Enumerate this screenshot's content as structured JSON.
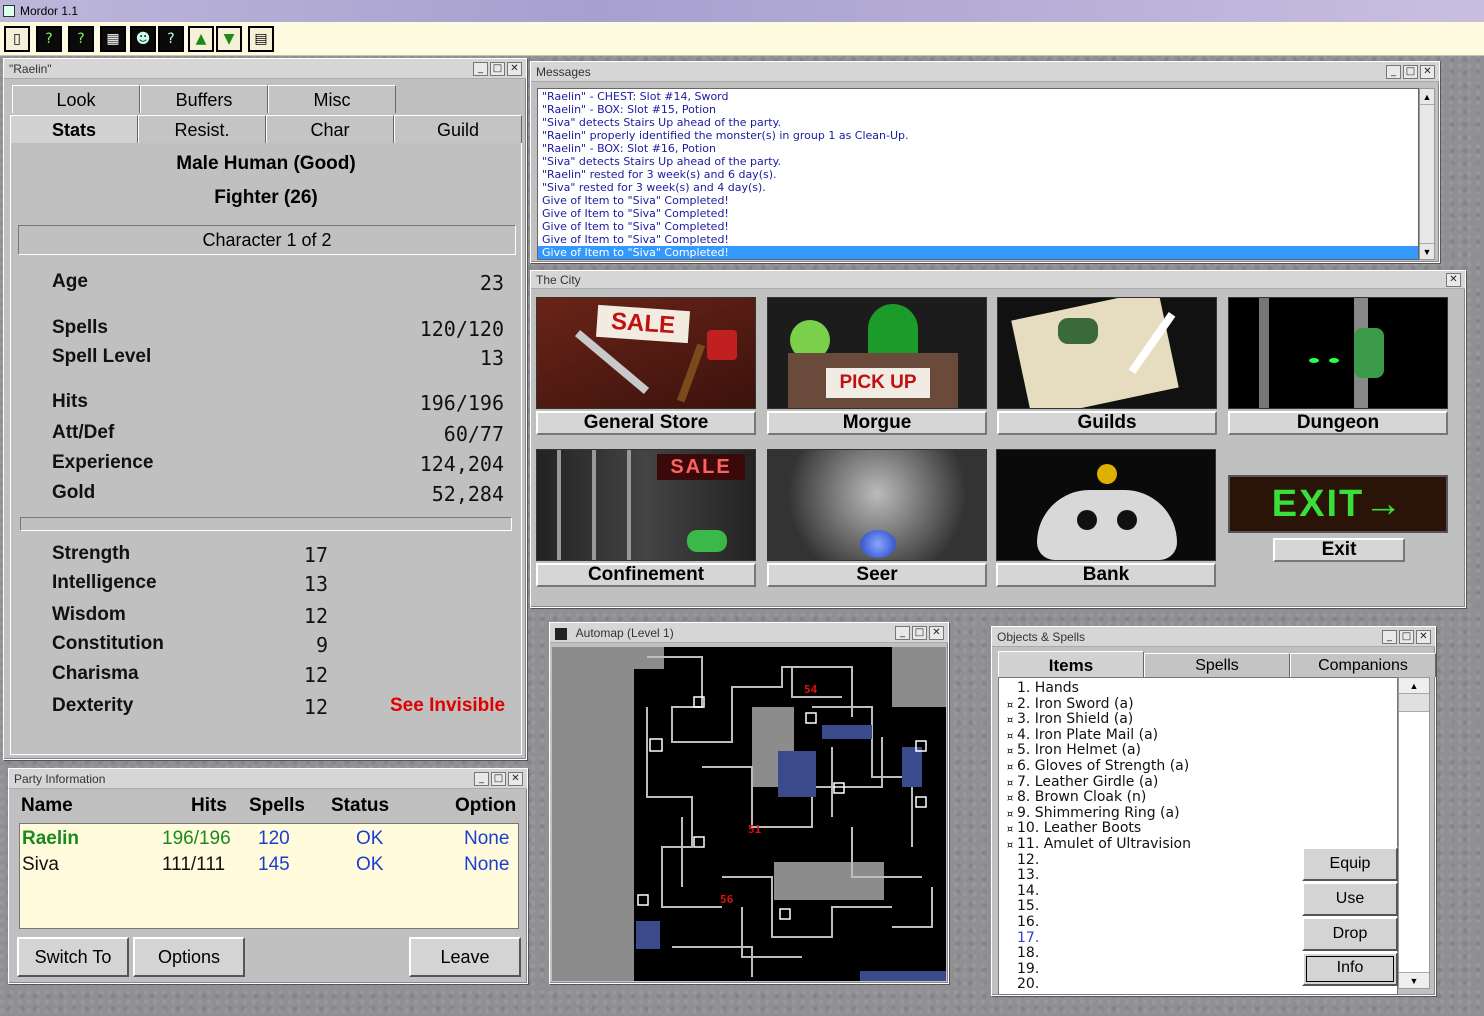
{
  "app": {
    "title": "Mordor 1.1"
  },
  "toolbar": {
    "icons": [
      "book-icon",
      "help-icon",
      "help-alt-icon",
      "map-grid-icon",
      "party-icon",
      "search-help-icon",
      "ascend-icon",
      "descend-icon",
      "window-icon"
    ]
  },
  "character_window": {
    "title": "\"Raelin\"",
    "tabs_row1": [
      "Look",
      "Buffers",
      "Misc"
    ],
    "tabs_row2": [
      "Stats",
      "Resist.",
      "Char",
      "Guild"
    ],
    "race_line": "Male Human (Good)",
    "class_line": "Fighter (26)",
    "character_index": "Character 1 of 2",
    "stats": [
      {
        "label": "Age",
        "value": "23"
      },
      {
        "label": "Spells",
        "value": "120/120"
      },
      {
        "label": "Spell Level",
        "value": "13"
      },
      {
        "label": "Hits",
        "value": "196/196"
      },
      {
        "label": "Att/Def",
        "value": "60/77"
      },
      {
        "label": "Experience",
        "value": "124,204"
      },
      {
        "label": "Gold",
        "value": "52,284"
      }
    ],
    "attributes": [
      {
        "label": "Strength",
        "value": "17"
      },
      {
        "label": "Intelligence",
        "value": "13"
      },
      {
        "label": "Wisdom",
        "value": "12"
      },
      {
        "label": "Constitution",
        "value": "9"
      },
      {
        "label": "Charisma",
        "value": "12"
      },
      {
        "label": "Dexterity",
        "value": "12"
      }
    ],
    "ability": "See Invisible",
    "ability_color": "#e00000"
  },
  "messages_window": {
    "title": "Messages",
    "lines": [
      "\"Raelin\" - CHEST: Slot #14, Sword",
      "\"Raelin\" - BOX: Slot #15, Potion",
      "\"Siva\" detects Stairs Up ahead of the party.",
      "\"Raelin\" properly identified the monster(s) in group 1 as Clean-Up.",
      "\"Raelin\" - BOX: Slot #16, Potion",
      "\"Siva\" detects Stairs Up ahead of the party.",
      "\"Raelin\" rested for 3 week(s) and 6 day(s).",
      "\"Siva\" rested for 3 week(s) and 4 day(s).",
      "Give of Item to \"Siva\" Completed!",
      "Give of Item to \"Siva\" Completed!",
      "Give of Item to \"Siva\" Completed!",
      "Give of Item to \"Siva\" Completed!",
      "Give of Item to \"Siva\" Completed!"
    ]
  },
  "city_window": {
    "title": "The City",
    "locations": [
      "General Store",
      "Morgue",
      "Guilds",
      "Dungeon",
      "Confinement",
      "Seer",
      "Bank",
      "Exit"
    ],
    "exit_sign": "EXIT→",
    "sign_sale": "SALE",
    "sign_pickup": "PICK UP"
  },
  "automap_window": {
    "title": "Automap (Level 1)",
    "markers": [
      "54",
      "51",
      "56"
    ]
  },
  "objects_window": {
    "title": "Objects & Spells",
    "tabs": [
      "Items",
      "Spells",
      "Companions"
    ],
    "items": [
      {
        "text": "1. Hands",
        "bullet": ""
      },
      {
        "text": "2. Iron Sword (a)",
        "bullet": "¤"
      },
      {
        "text": "3. Iron Shield (a)",
        "bullet": "¤"
      },
      {
        "text": "4. Iron Plate Mail (a)",
        "bullet": "¤"
      },
      {
        "text": "5. Iron Helmet (a)",
        "bullet": "¤"
      },
      {
        "text": "6. Gloves of Strength (a)",
        "bullet": "¤"
      },
      {
        "text": "7. Leather Girdle (a)",
        "bullet": "¤"
      },
      {
        "text": "8. Brown Cloak (n)",
        "bullet": "¤"
      },
      {
        "text": "9. Shimmering Ring (a)",
        "bullet": "¤"
      },
      {
        "text": "10. Leather Boots",
        "bullet": "¤"
      },
      {
        "text": "11. Amulet of Ultravision",
        "bullet": "¤"
      },
      {
        "text": "12.",
        "bullet": ""
      },
      {
        "text": "13.",
        "bullet": ""
      },
      {
        "text": "14.",
        "bullet": ""
      },
      {
        "text": "15.",
        "bullet": ""
      },
      {
        "text": "16.",
        "bullet": ""
      },
      {
        "text": "17.",
        "bullet": "",
        "color": "#2a3fd0"
      },
      {
        "text": "18.",
        "bullet": ""
      },
      {
        "text": "19.",
        "bullet": ""
      },
      {
        "text": "20.",
        "bullet": ""
      }
    ],
    "buttons": [
      "Equip",
      "Use",
      "Drop",
      "Info"
    ]
  },
  "party_window": {
    "title": "Party Information",
    "headers": [
      "Name",
      "Hits",
      "Spells",
      "Status",
      "Option"
    ],
    "members": [
      {
        "name": "Raelin",
        "hits": "196/196",
        "spells": "120",
        "status": "OK",
        "option": "None"
      },
      {
        "name": "Siva",
        "hits": "111/111",
        "spells": "145",
        "status": "OK",
        "option": "None"
      }
    ],
    "buttons": [
      "Switch To",
      "Options",
      "Leave"
    ]
  }
}
